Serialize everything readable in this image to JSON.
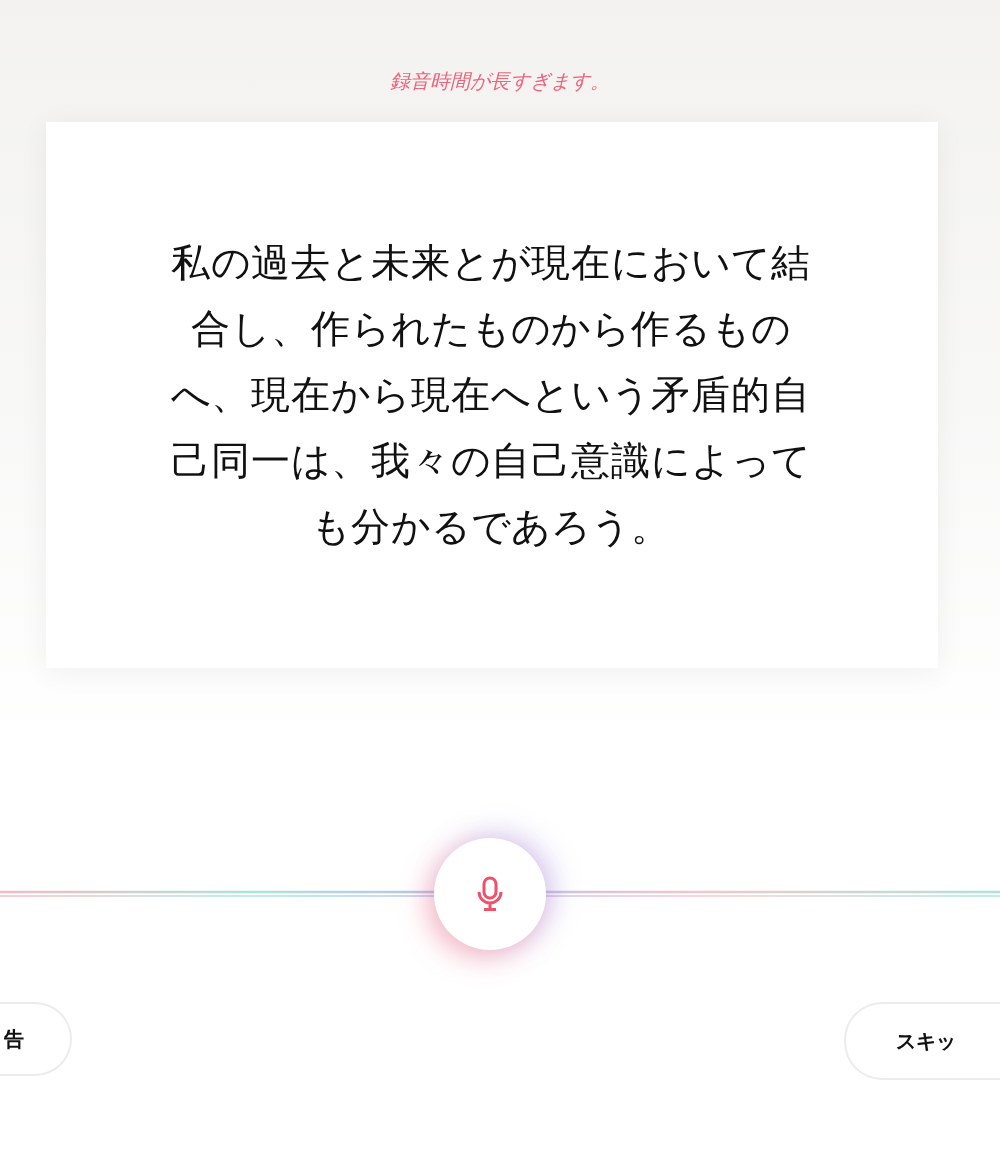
{
  "error_message": "録音時間が長すぎます。",
  "prompt_text": "私の過去と未来とが現在において結合し、作られたものから作るものへ、現在から現在へという矛盾的自己同一は、我々の自己意識によっても分かるであろう。",
  "recording": {
    "active": true
  },
  "buttons": [
    {
      "label": "告",
      "kind": "left"
    },
    {
      "label": "スキッ",
      "kind": "right"
    }
  ]
}
